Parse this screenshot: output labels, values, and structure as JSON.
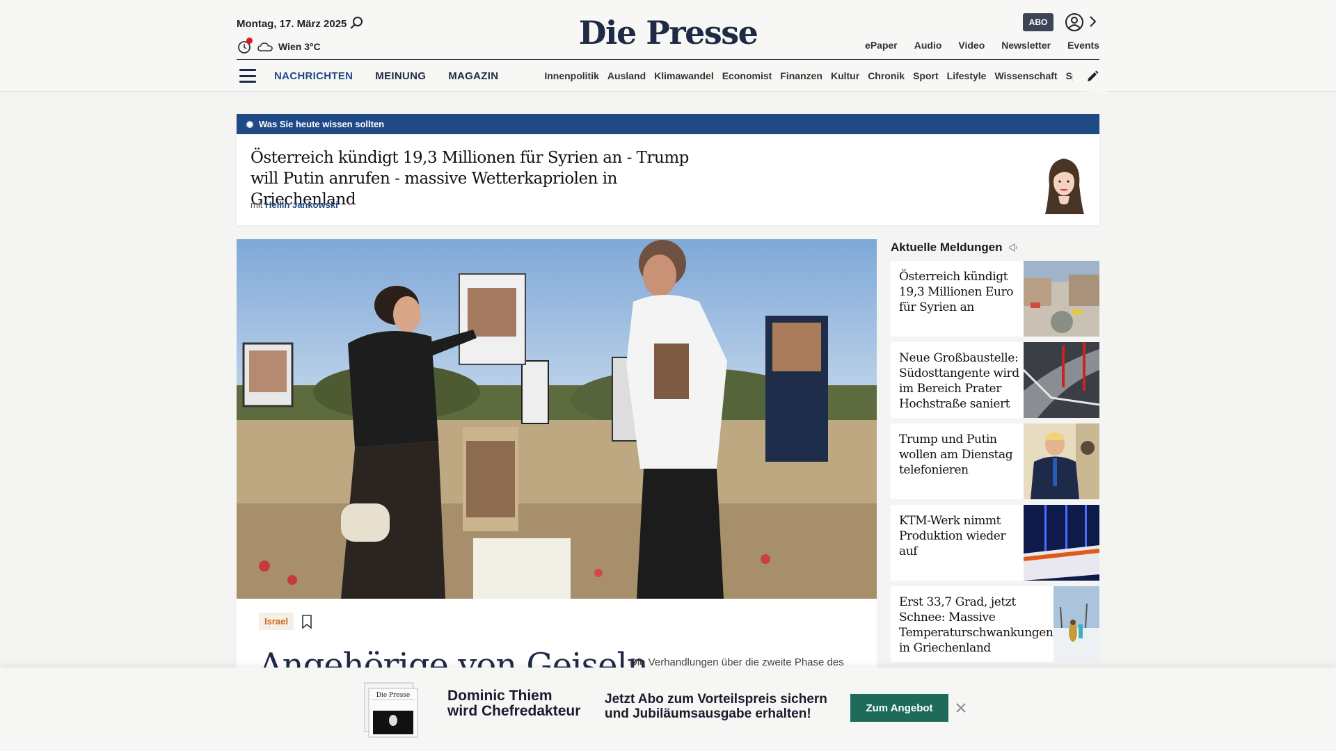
{
  "header": {
    "date": "Montag, 17. März 2025",
    "weather": "Wien 3°C",
    "logo": "Die Presse",
    "abo_label": "ABO",
    "top_links": [
      "ePaper",
      "Audio",
      "Video",
      "Newsletter",
      "Events"
    ],
    "main_nav": [
      "NACHRICHTEN",
      "MEINUNG",
      "MAGAZIN"
    ],
    "sub_nav": [
      "Innenpolitik",
      "Ausland",
      "Klimawandel",
      "Economist",
      "Finanzen",
      "Kultur",
      "Chronik",
      "Sport",
      "Lifestyle",
      "Wissenschaft",
      "Spectrum"
    ]
  },
  "briefing": {
    "label": "Was Sie heute wissen sollten",
    "title": "Österreich kündigt 19,3 Millionen für Syrien an - Trump will Putin anrufen - massive Wetterkapriolen in Griechenland",
    "author_prefix": "mit",
    "author": "Hellin Jankowski"
  },
  "lead": {
    "tag": "Israel",
    "headline": "Angehörige von Geiseln",
    "teaser": "Die Verhandlungen über die zweite Phase des"
  },
  "sidebar": {
    "heading": "Aktuelle Meldungen",
    "items": [
      {
        "title": "Österreich kündigt 19,3 Millionen Euro für Syrien an"
      },
      {
        "title": "Neue Großbaustelle: Südosttangente wird im Bereich Prater Hochstraße saniert"
      },
      {
        "title": "Trump und Putin wollen am Dienstag telefonieren"
      },
      {
        "title": "KTM-Werk nimmt Produktion wieder auf"
      },
      {
        "title": "Erst 33,7 Grad, jetzt Schnee: Massive Temperaturschwankungen in Griechenland"
      }
    ]
  },
  "promo": {
    "name_line1": "Dominic Thiem",
    "name_line2": "wird Chefredakteur",
    "text_line1": "Jetzt Abo zum Vorteilspreis sichern",
    "text_line2": "und Jubiläumsausgabe erhalten!",
    "button": "Zum Angebot",
    "paper_logo": "Die Presse"
  },
  "colors": {
    "brand_blue": "#1f4a86",
    "logo_navy": "#1f2a44",
    "promo_green": "#1e6b5c",
    "tag_orange": "#c46a1f",
    "notification_red": "#d71920"
  }
}
